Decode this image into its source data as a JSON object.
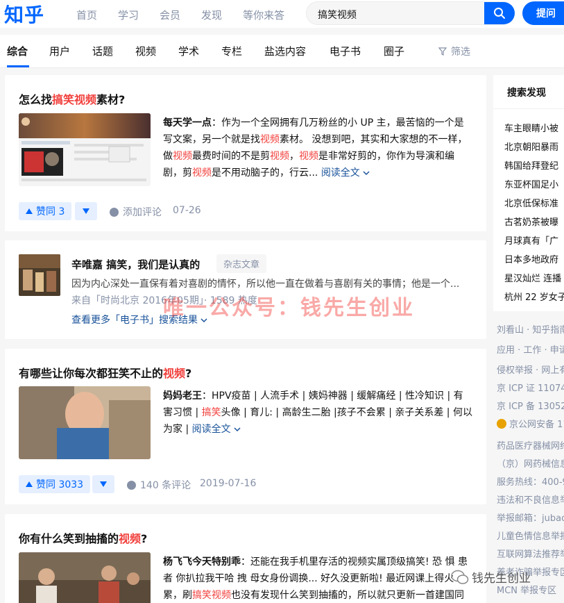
{
  "header": {
    "logo": "知乎",
    "nav": [
      "首页",
      "学习",
      "会员",
      "发现",
      "等你来答"
    ],
    "search_value": "搞笑视频",
    "ask_label": "提问"
  },
  "tabs": {
    "items": [
      "综合",
      "用户",
      "话题",
      "视频",
      "学术",
      "专栏",
      "盐选内容",
      "电子书",
      "圈子"
    ],
    "filter_label": "筛选"
  },
  "results": {
    "r1": {
      "title_pre": "怎么找",
      "title_hl": "搞笑视频",
      "title_post": "素材?",
      "author": "每天学一点",
      "excerpt": [
        {
          "t": "：作为一个全网拥有几万粉丝的小 UP 主，最苦恼的一个是写文案，另一个就是找"
        },
        {
          "t": "视频",
          "hl": true
        },
        {
          "t": "素材。 没想到吧，其实和大家想的不一样，做"
        },
        {
          "t": "视频",
          "hl": true
        },
        {
          "t": "最费时间的不是剪"
        },
        {
          "t": "视频",
          "hl": true
        },
        {
          "t": "，"
        },
        {
          "t": "视频",
          "hl": true
        },
        {
          "t": "是非常好剪的，你作为导演和编剧，剪"
        },
        {
          "t": "视频",
          "hl": true
        },
        {
          "t": "是不用动脑子的，行云..."
        }
      ],
      "read_more": "阅读全文",
      "vote": "赞同 3",
      "comment": "添加评论",
      "date": "07-26"
    },
    "r2": {
      "title": "辛唯嘉 搞笑，我们是认真的",
      "tag": "杂志文章",
      "desc": "因为内心深处一直保有着对喜剧的情怀，所以他一直在做着与喜剧有关的事情；他是一个...",
      "meta": "来自「时尚北京 2016年05期」· 1589 热度",
      "more": "查看更多「电子书」搜索结果"
    },
    "r3": {
      "title_pre": "有哪些让你每次都狂笑不止的",
      "title_hl": "视频",
      "title_post": "?",
      "author": "妈妈老王",
      "excerpt": [
        {
          "t": "：HPV疫苗 | 人流手术 | 姨妈神器 | 缓解痛经 | 性冷知识 | 有害习惯 | "
        },
        {
          "t": "搞笑",
          "hl": true
        },
        {
          "t": "头像 | 育儿: | 高龄生二胎 |孩子不会累 | 亲子关系差 | 何以为家 | "
        }
      ],
      "read_more": "阅读全文",
      "vote": "赞同 3033",
      "comment": "140 条评论",
      "date": "2019-07-16"
    },
    "r4": {
      "title_pre": "你有什么笑到抽搐的",
      "title_hl": "视频",
      "title_post": "?",
      "author": "杨飞飞今天特别乖",
      "excerpt": [
        {
          "t": "：还能在我手机里存活的视频实属顶级搞笑! 恐 惧 患者 你扒拉我干哈 拽 母女身份调换... 好久没更新啦! 最近网课上得火累，刷"
        },
        {
          "t": "搞笑视频",
          "hl": true
        },
        {
          "t": "也没有发现什么笑到抽搐的，所以就只更新一首建国同"
        }
      ]
    }
  },
  "watermark": "唯一公众号：钱先生创业",
  "wechat_mark": "钱先生创业",
  "sidebar": {
    "title": "搜索发现",
    "items": [
      "车主眼睛小被",
      "北京朝阳暴雨",
      "韩国给拜登纪",
      "东亚杯国足小",
      "北京低保标准",
      "古茗奶茶被曝",
      "月球真有「广",
      "日本多地政府",
      "星汉灿烂 连播",
      "杭州 22 岁女子"
    ]
  },
  "footer": [
    "刘看山 · 知乎指南",
    "应用 · 工作 · 申请",
    "侵权举报 · 网上有",
    "京 ICP 证 11074",
    "京 ICP 备 13052",
    "京公网安备 1101",
    "药品医疗器械网络",
    "（京）网药械信息",
    "服务热线：400-9",
    "违法和不良信息举",
    "举报邮箱：jubao",
    "儿童色情信息举报",
    "互联网算法推荐举",
    "养老诈骗举报专区",
    "MCN 举报专区"
  ]
}
